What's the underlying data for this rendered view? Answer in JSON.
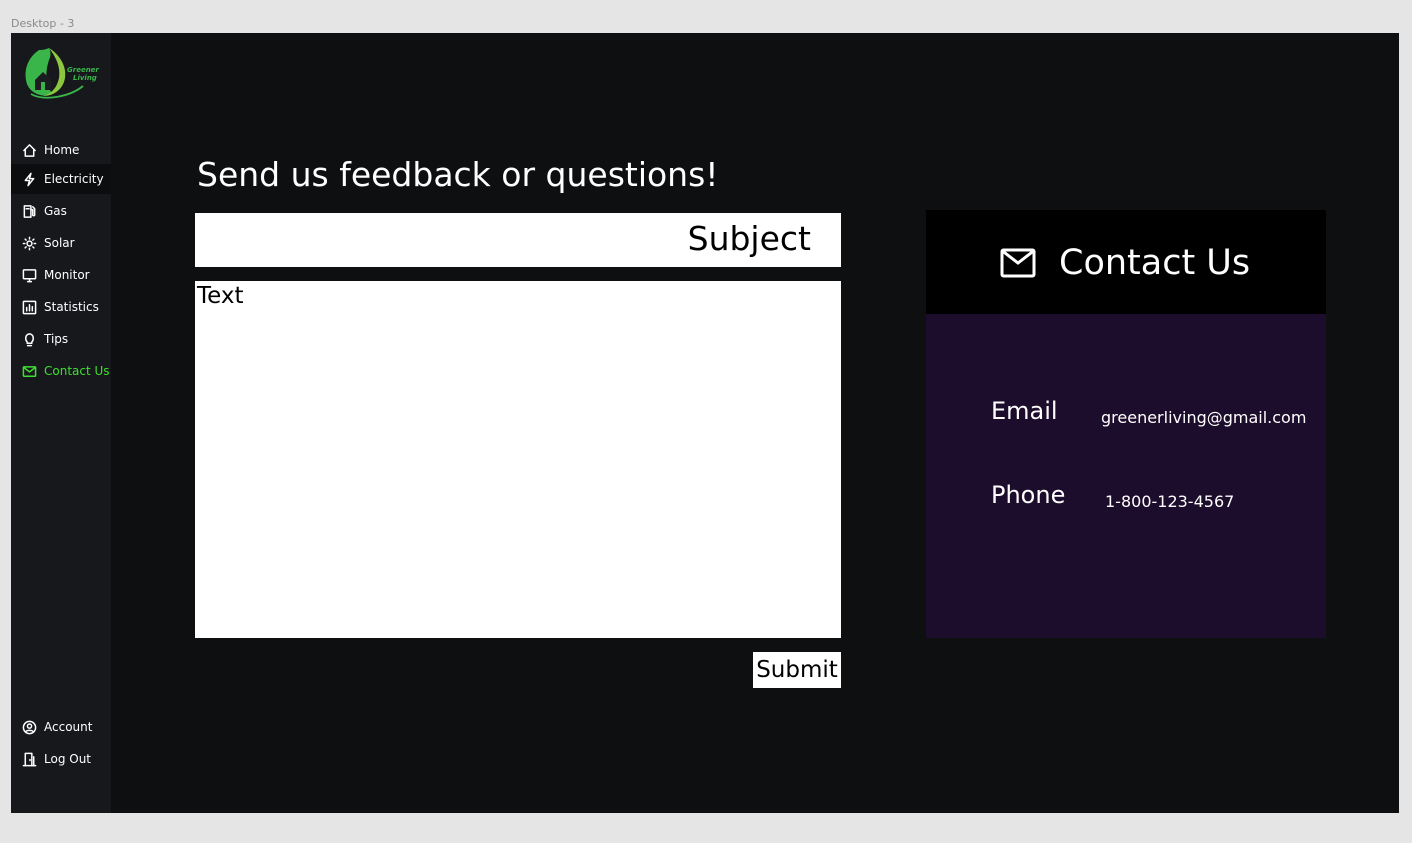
{
  "frame_label": "Desktop - 3",
  "brand": {
    "logo_text_line1": "Greener",
    "logo_text_line2": "Living"
  },
  "sidebar": {
    "items": [
      {
        "label": "Home",
        "icon": "home-icon"
      },
      {
        "label": "Electricity",
        "icon": "lightning-icon"
      },
      {
        "label": "Gas",
        "icon": "gas-pump-icon"
      },
      {
        "label": "Solar",
        "icon": "sun-icon"
      },
      {
        "label": "Monitor",
        "icon": "monitor-icon"
      },
      {
        "label": "Statistics",
        "icon": "bar-chart-icon"
      },
      {
        "label": "Tips",
        "icon": "lightbulb-icon"
      },
      {
        "label": "Contact Us",
        "icon": "mail-icon"
      }
    ],
    "bottom_items": [
      {
        "label": "Account",
        "icon": "user-circle-icon"
      },
      {
        "label": "Log Out",
        "icon": "door-exit-icon"
      }
    ],
    "highlighted_item": "Electricity",
    "current_item": "Contact Us"
  },
  "main": {
    "title": "Send us feedback or questions!",
    "subject_placeholder": "Subject",
    "text_placeholder": "Text",
    "submit_label": "Submit"
  },
  "contact": {
    "title": "Contact Us",
    "email_label": "Email",
    "email_value": "greenerliving@gmail.com",
    "phone_label": "Phone",
    "phone_value": "1-800-123-4567"
  },
  "colors": {
    "page_background": "#0e0f11",
    "sidebar_background": "#16181c",
    "active_nav": "#3ee02f",
    "contact_header": "#000000",
    "contact_body": "#1d0d2c",
    "canvas": "#e5e5e5"
  }
}
